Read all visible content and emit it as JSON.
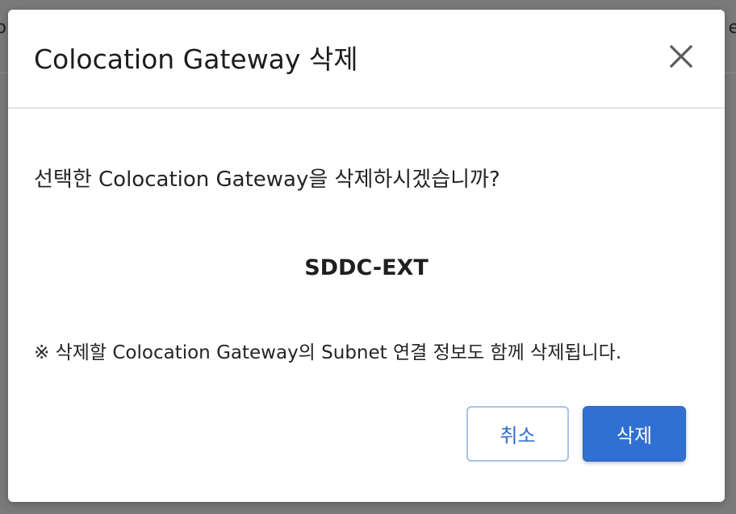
{
  "backdrop": {
    "left_fragment": "p",
    "right_fragment": "e"
  },
  "dialog": {
    "title": "Colocation Gateway 삭제",
    "close_icon": "close-icon",
    "confirm_message": "선택한 Colocation Gateway을 삭제하시겠습니까?",
    "target_name": "SDDC-EXT",
    "note": "※ 삭제할 Colocation Gateway의 Subnet 연결 정보도 함께 삭제됩니다.",
    "cancel_label": "취소",
    "delete_label": "삭제"
  },
  "colors": {
    "primary": "#3070d2",
    "cancel_border": "#a9c2e6",
    "overlay": "#7a7a7a"
  }
}
